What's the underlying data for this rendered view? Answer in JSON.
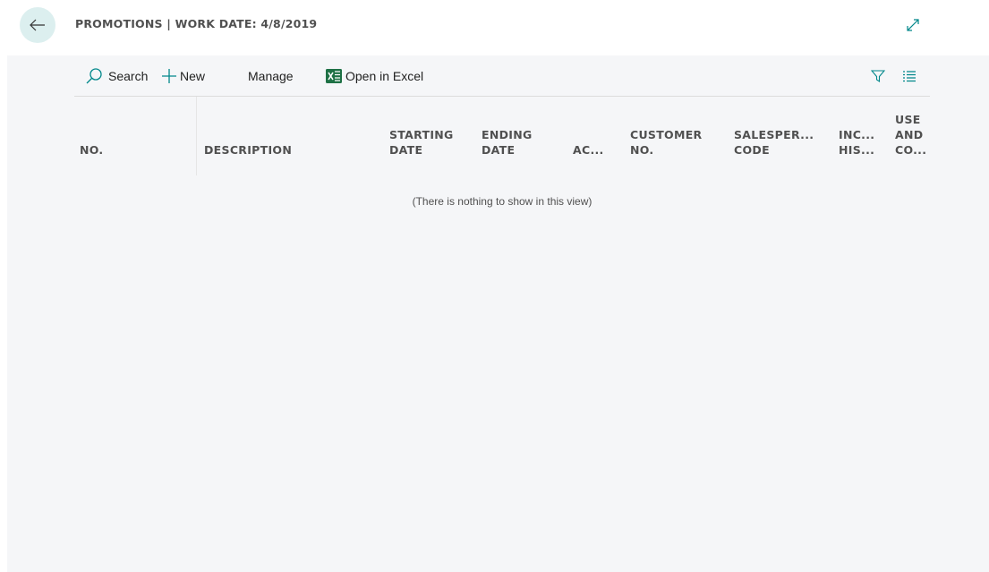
{
  "header": {
    "title": "PROMOTIONS | WORK DATE: 4/8/2019",
    "back_icon": "arrow-left-icon",
    "expand_icon": "expand-diagonal-icon"
  },
  "toolbar": {
    "search_label": "Search",
    "new_label": "New",
    "manage_label": "Manage",
    "excel_label": "Open in Excel",
    "filter_icon": "filter-icon",
    "list_icon": "list-view-icon"
  },
  "table": {
    "columns": [
      {
        "line1": "",
        "line2": "",
        "line3": "NO."
      },
      {
        "line1": "",
        "line2": "",
        "line3": "DESCRIPTION"
      },
      {
        "line1": "",
        "line2": "STARTING",
        "line3": "DATE"
      },
      {
        "line1": "",
        "line2": "ENDING",
        "line3": "DATE"
      },
      {
        "line1": "",
        "line2": "",
        "line3": "AC..."
      },
      {
        "line1": "",
        "line2": "CUSTOMER",
        "line3": "NO."
      },
      {
        "line1": "",
        "line2": "SALESPER...",
        "line3": "CODE"
      },
      {
        "line1": "",
        "line2": "INC...",
        "line3": "HIS..."
      },
      {
        "line1": "USE",
        "line2": "AND",
        "line3": "CO..."
      }
    ],
    "empty_message": "(There is nothing to show in this view)"
  },
  "colors": {
    "accent": "#00878a",
    "back_button_bg": "#dcefef",
    "excel_green": "#1e7145"
  }
}
